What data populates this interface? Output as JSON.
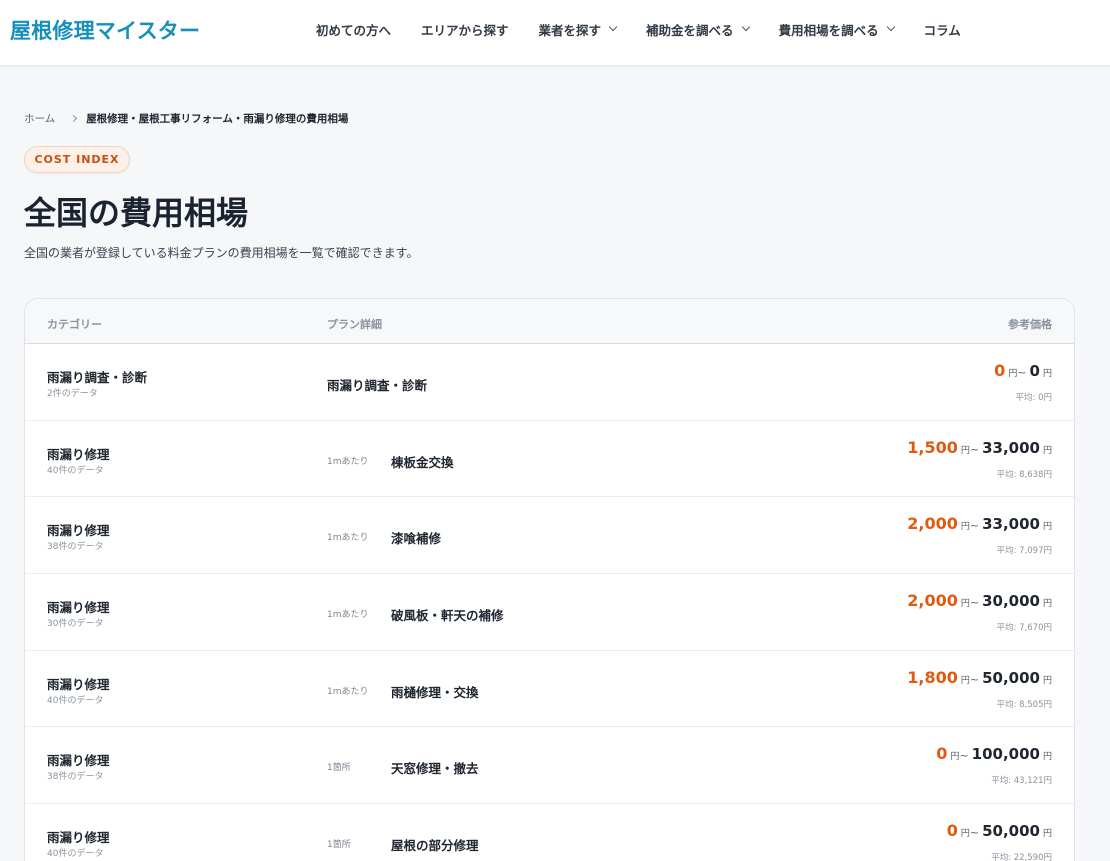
{
  "header": {
    "logo": "屋根修理マイスター",
    "nav": [
      {
        "label": "初めての方へ",
        "dropdown": false
      },
      {
        "label": "エリアから探す",
        "dropdown": false
      },
      {
        "label": "業者を探す",
        "dropdown": true
      },
      {
        "label": "補助金を調べる",
        "dropdown": true
      },
      {
        "label": "費用相場を調べる",
        "dropdown": true
      },
      {
        "label": "コラム",
        "dropdown": false
      }
    ]
  },
  "breadcrumb": {
    "home": "ホーム",
    "current": "屋根修理・屋根工事リフォーム・雨漏り修理の費用相場"
  },
  "badge": "COST INDEX",
  "page": {
    "title": "全国の費用相場",
    "description": "全国の業者が登録している料金プランの費用相場を一覧で確認できます。"
  },
  "table": {
    "headers": {
      "category": "カテゴリー",
      "plan": "プラン詳細",
      "price": "参考価格"
    },
    "yen": "円",
    "tilde": "~",
    "rows": [
      {
        "category": "雨漏り調査・診断",
        "count": "2件のデータ",
        "unit": "",
        "plan": "雨漏り調査・診断",
        "min": "0",
        "max": "0",
        "avg": "平均: 0円"
      },
      {
        "category": "雨漏り修理",
        "count": "40件のデータ",
        "unit": "1mあたり",
        "plan": "棟板金交換",
        "min": "1,500",
        "max": "33,000",
        "avg": "平均: 8,638円"
      },
      {
        "category": "雨漏り修理",
        "count": "38件のデータ",
        "unit": "1mあたり",
        "plan": "漆喰補修",
        "min": "2,000",
        "max": "33,000",
        "avg": "平均: 7,097円"
      },
      {
        "category": "雨漏り修理",
        "count": "30件のデータ",
        "unit": "1mあたり",
        "plan": "破風板・軒天の補修",
        "min": "2,000",
        "max": "30,000",
        "avg": "平均: 7,670円"
      },
      {
        "category": "雨漏り修理",
        "count": "40件のデータ",
        "unit": "1mあたり",
        "plan": "雨樋修理・交換",
        "min": "1,800",
        "max": "50,000",
        "avg": "平均: 8,505円"
      },
      {
        "category": "雨漏り修理",
        "count": "38件のデータ",
        "unit": "1箇所",
        "plan": "天窓修理・撤去",
        "min": "0",
        "max": "100,000",
        "avg": "平均: 43,121円"
      },
      {
        "category": "雨漏り修理",
        "count": "40件のデータ",
        "unit": "1箇所",
        "plan": "屋根の部分修理",
        "min": "0",
        "max": "50,000",
        "avg": "平均: 22,590円"
      }
    ]
  },
  "colors": {
    "brand": "#1690b8",
    "price_accent": "#e05a10",
    "badge_bg": "#fdf0e8",
    "page_bg": "#f6f7f9"
  }
}
